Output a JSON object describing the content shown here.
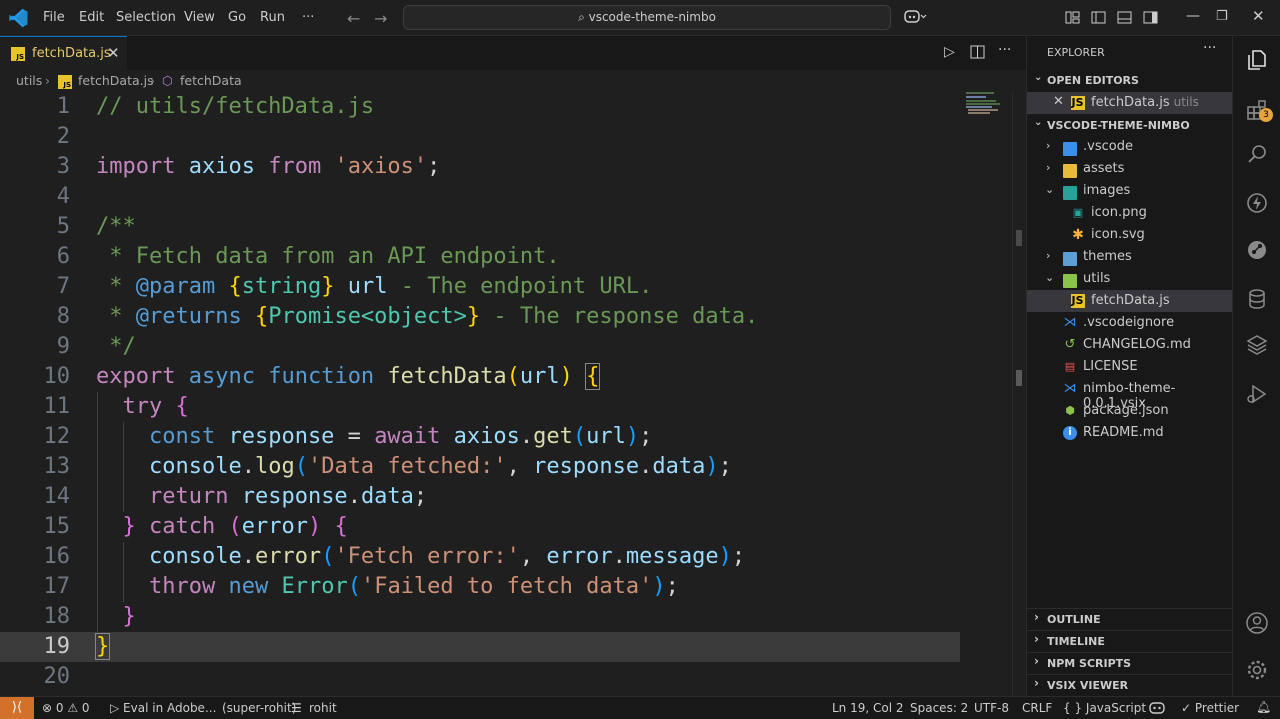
{
  "titlebar": {
    "menus": [
      "File",
      "Edit",
      "Selection",
      "View",
      "Go",
      "Run",
      "···"
    ],
    "search": "vscode-theme-nimbo"
  },
  "tab": {
    "label": "fetchData.js",
    "file_type": "JS"
  },
  "breadcrumb": {
    "folder": "utils",
    "file": "fetchData.js",
    "symbol": "fetchData"
  },
  "editor": {
    "current_line": 19,
    "line_numbers": [
      "1",
      "2",
      "3",
      "4",
      "5",
      "6",
      "7",
      "8",
      "9",
      "10",
      "11",
      "12",
      "13",
      "14",
      "15",
      "16",
      "17",
      "18",
      "19",
      "20"
    ]
  },
  "explorer": {
    "title": "EXPLORER",
    "more": "···",
    "open_editors_label": "OPEN EDITORS",
    "open_editor_file": "fetchData.js",
    "open_editor_dir": "utils",
    "project_label": "VSCODE-THEME-NIMBO",
    "tree": [
      {
        "name": ".vscode",
        "kind": "folder"
      },
      {
        "name": "assets",
        "kind": "folder"
      },
      {
        "name": "images",
        "kind": "folder-open"
      },
      {
        "name": "icon.png",
        "kind": "file"
      },
      {
        "name": "icon.svg",
        "kind": "file"
      },
      {
        "name": "themes",
        "kind": "folder"
      },
      {
        "name": "utils",
        "kind": "folder-open"
      },
      {
        "name": "fetchData.js",
        "kind": "file"
      },
      {
        "name": ".vscodeignore",
        "kind": "file"
      },
      {
        "name": "CHANGELOG.md",
        "kind": "file"
      },
      {
        "name": "LICENSE",
        "kind": "file"
      },
      {
        "name": "nimbo-theme-0.0.1.vsix",
        "kind": "file"
      },
      {
        "name": "package.json",
        "kind": "file"
      },
      {
        "name": "README.md",
        "kind": "file"
      }
    ],
    "bottom_sections": [
      "OUTLINE",
      "TIMELINE",
      "NPM SCRIPTS",
      "VSIX VIEWER"
    ]
  },
  "activity": {
    "extensions_badge": "3"
  },
  "status": {
    "problems": "⊗ 0 ⚠ 0",
    "eval": "▷ Eval in Adobe...",
    "profile": "(super-rohit)",
    "user": "rohit",
    "position": "Ln 19, Col 2",
    "spaces": "Spaces: 2",
    "encoding": "UTF-8",
    "eol": "CRLF",
    "language": "{ } JavaScript",
    "prettier": "✓ Prettier"
  },
  "colors": {
    "accent": "#0078d4",
    "remote": "#d3712a",
    "js": "#e8c42a",
    "background": "#1f1f1f"
  }
}
